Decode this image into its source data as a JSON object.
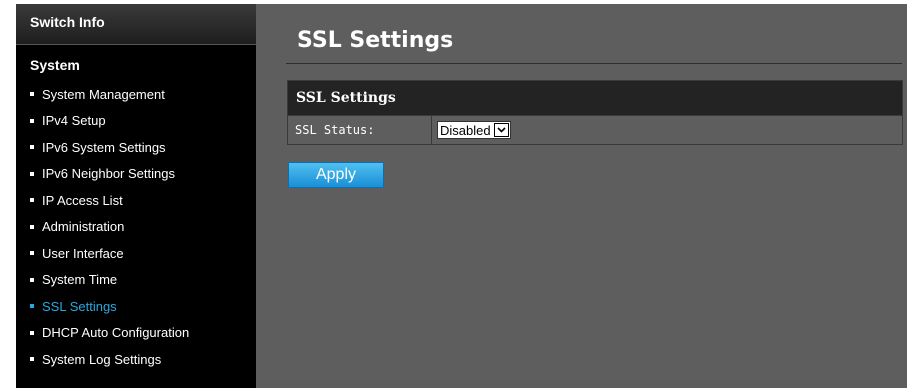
{
  "sidebar": {
    "header": "Switch Info",
    "section": "System",
    "items": [
      {
        "label": "System Management",
        "active": false
      },
      {
        "label": "IPv4 Setup",
        "active": false
      },
      {
        "label": "IPv6 System Settings",
        "active": false
      },
      {
        "label": "IPv6 Neighbor Settings",
        "active": false
      },
      {
        "label": "IP Access List",
        "active": false
      },
      {
        "label": "Administration",
        "active": false
      },
      {
        "label": "User Interface",
        "active": false
      },
      {
        "label": "System Time",
        "active": false
      },
      {
        "label": "SSL Settings",
        "active": true
      },
      {
        "label": "DHCP Auto Configuration",
        "active": false
      },
      {
        "label": "System Log Settings",
        "active": false
      }
    ]
  },
  "main": {
    "title": "SSL Settings",
    "panel": {
      "title": "SSL Settings",
      "ssl_status_label": "SSL Status:",
      "ssl_status_value": "Disabled"
    },
    "apply_label": "Apply"
  },
  "colors": {
    "active": "#29a8e0",
    "content_bg": "#5e5e5e",
    "sidebar_bg": "#000000",
    "button": "#2aa0e6"
  },
  "icons": {
    "dropdown": "chevron-down-icon",
    "bullet": "bullet-icon"
  }
}
